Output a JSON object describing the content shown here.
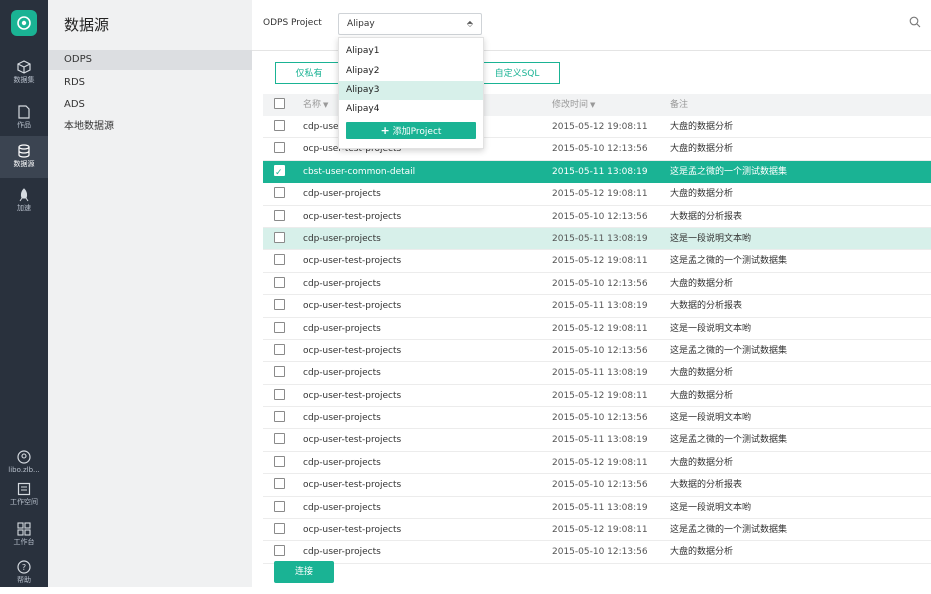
{
  "rail": {
    "items": [
      {
        "label": "数据集",
        "icon": "cube-icon"
      },
      {
        "label": "作品",
        "icon": "document-icon"
      },
      {
        "label": "数据源",
        "icon": "database-icon",
        "active": true
      },
      {
        "label": "加速",
        "icon": "rocket-icon"
      }
    ],
    "bottom": [
      {
        "label": "libo.zlb...",
        "icon": "user-icon"
      },
      {
        "label": "工作空间",
        "icon": "workspace-icon"
      },
      {
        "label": "工作台",
        "icon": "grid-icon"
      },
      {
        "label": "帮助",
        "icon": "help-icon"
      }
    ]
  },
  "sidebar": {
    "title": "数据源",
    "items": [
      {
        "label": "ODPS"
      },
      {
        "label": "RDS"
      },
      {
        "label": "ADS"
      },
      {
        "label": "本地数据源"
      }
    ]
  },
  "header": {
    "project_label": "ODPS Project",
    "project_value": "Alipay"
  },
  "tabs": {
    "private": "仅私有",
    "public": "全部",
    "custom_sql": "自定义SQL"
  },
  "dropdown": {
    "options": [
      "Alipay1",
      "Alipay2",
      "Alipay3",
      "Alipay4"
    ],
    "add_label": "添加Project"
  },
  "table": {
    "headers": {
      "name": "名称",
      "modified": "修改时间",
      "note": "备注"
    },
    "rows": [
      {
        "name": "cdp-user-projects",
        "time": "2015-05-12 19:08:11",
        "note": "大盘的数据分析"
      },
      {
        "name": "ocp-user-test-projects",
        "time": "2015-05-10 12:13:56",
        "note": "大盘的数据分析"
      },
      {
        "name": "cbst-user-common-detail",
        "time": "2015-05-11 13:08:19",
        "note": "这是孟之微的一个测试数据集"
      },
      {
        "name": "cdp-user-projects",
        "time": "2015-05-12 19:08:11",
        "note": "大盘的数据分析"
      },
      {
        "name": "ocp-user-test-projects",
        "time": "2015-05-10 12:13:56",
        "note": "大数据的分析报表"
      },
      {
        "name": "cdp-user-projects",
        "time": "2015-05-11 13:08:19",
        "note": "这是一段说明文本哟"
      },
      {
        "name": "ocp-user-test-projects",
        "time": "2015-05-12 19:08:11",
        "note": "这是孟之微的一个测试数据集"
      },
      {
        "name": "cdp-user-projects",
        "time": "2015-05-10 12:13:56",
        "note": "大盘的数据分析"
      },
      {
        "name": "ocp-user-test-projects",
        "time": "2015-05-11 13:08:19",
        "note": "大数据的分析报表"
      },
      {
        "name": "cdp-user-projects",
        "time": "2015-05-12 19:08:11",
        "note": "这是一段说明文本哟"
      },
      {
        "name": "ocp-user-test-projects",
        "time": "2015-05-10 12:13:56",
        "note": "这是孟之微的一个测试数据集"
      },
      {
        "name": "cdp-user-projects",
        "time": "2015-05-11 13:08:19",
        "note": "大盘的数据分析"
      },
      {
        "name": "ocp-user-test-projects",
        "time": "2015-05-12 19:08:11",
        "note": "大盘的数据分析"
      },
      {
        "name": "cdp-user-projects",
        "time": "2015-05-10 12:13:56",
        "note": "这是一段说明文本哟"
      },
      {
        "name": "ocp-user-test-projects",
        "time": "2015-05-11 13:08:19",
        "note": "这是孟之微的一个测试数据集"
      },
      {
        "name": "cdp-user-projects",
        "time": "2015-05-12 19:08:11",
        "note": "大盘的数据分析"
      },
      {
        "name": "ocp-user-test-projects",
        "time": "2015-05-10 12:13:56",
        "note": "大数据的分析报表"
      },
      {
        "name": "cdp-user-projects",
        "time": "2015-05-11 13:08:19",
        "note": "这是一段说明文本哟"
      },
      {
        "name": "ocp-user-test-projects",
        "time": "2015-05-12 19:08:11",
        "note": "这是孟之微的一个测试数据集"
      },
      {
        "name": "cdp-user-projects",
        "time": "2015-05-10 12:13:56",
        "note": "大盘的数据分析"
      }
    ]
  },
  "connect_label": "连接",
  "colors": {
    "accent": "#1ab394",
    "rail": "#29313d",
    "highlight": "#d7f0ea"
  }
}
